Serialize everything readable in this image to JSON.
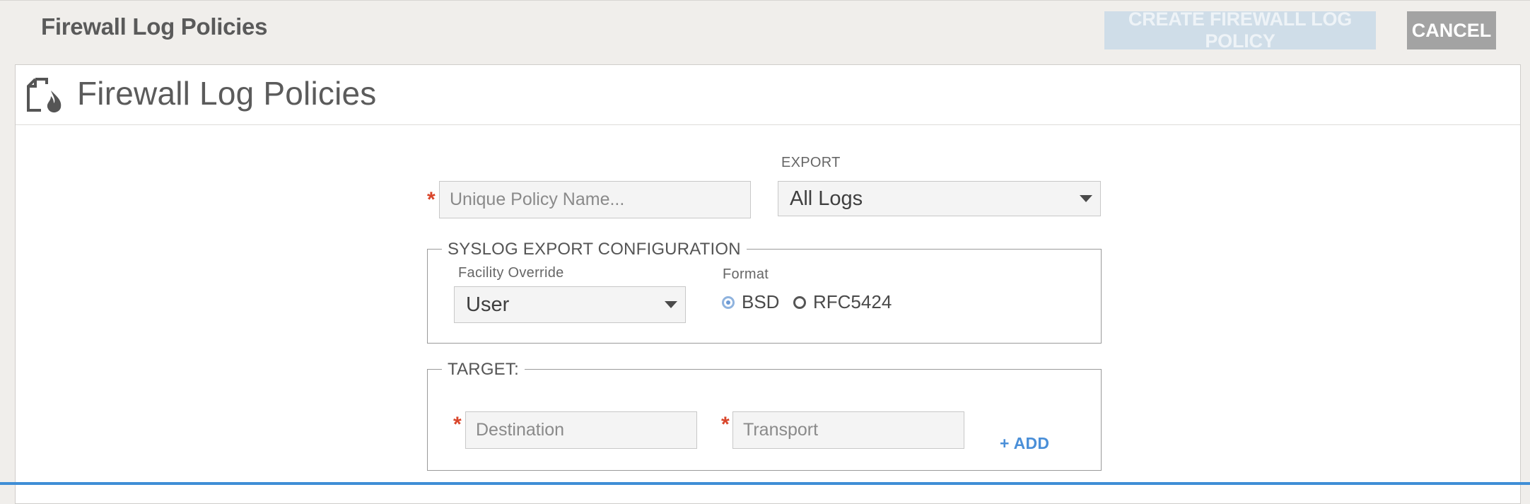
{
  "topbar": {
    "title": "Firewall Log Policies",
    "create_label": "CREATE FIREWALL LOG POLICY",
    "cancel_label": "CANCEL"
  },
  "panel": {
    "title": "Firewall Log Policies",
    "icon": "firewall-log-icon"
  },
  "form": {
    "required_mark": "*",
    "policy_name": {
      "value": "",
      "placeholder": "Unique Policy Name..."
    },
    "export": {
      "label": "EXPORT",
      "selected": "All Logs"
    },
    "syslog": {
      "legend": "SYSLOG EXPORT CONFIGURATION",
      "facility_label": "Facility Override",
      "facility_selected": "User",
      "format_label": "Format",
      "format_options": [
        "BSD",
        "RFC5424"
      ],
      "format_selected": "BSD"
    },
    "target": {
      "legend": "TARGET:",
      "destination": {
        "value": "",
        "placeholder": "Destination"
      },
      "transport": {
        "value": "",
        "placeholder": "Transport"
      },
      "add_label": "+ ADD"
    }
  },
  "colors": {
    "accent": "#3f8ed6",
    "required": "#d9452a",
    "link": "#4a8fd8"
  }
}
